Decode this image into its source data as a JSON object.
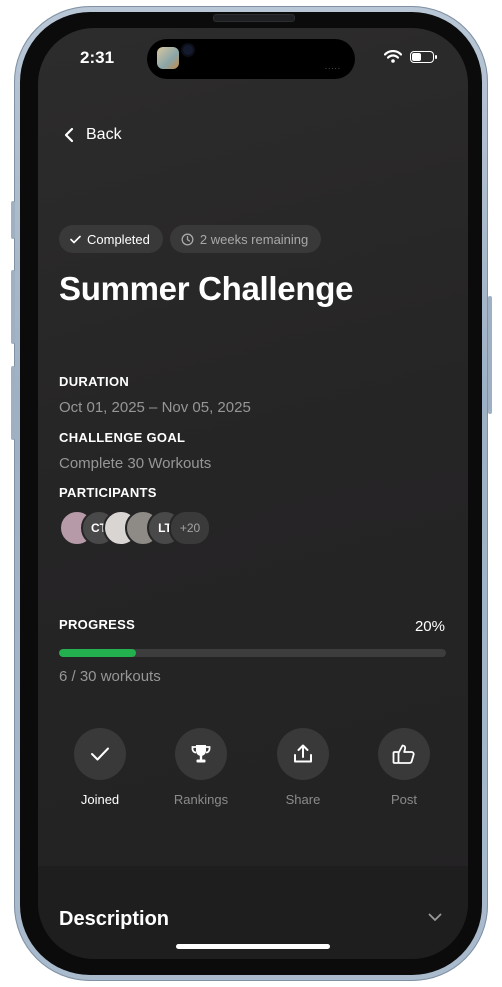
{
  "status_bar": {
    "time": "2:31",
    "island_dots": "....."
  },
  "nav": {
    "back_label": "Back"
  },
  "chips": {
    "completed": "Completed",
    "remaining": "2 weeks remaining"
  },
  "challenge": {
    "title": "Summer Challenge",
    "duration_label": "DURATION",
    "duration_value": "Oct 01, 2025 – Nov 05, 2025",
    "goal_label": "CHALLENGE GOAL",
    "goal_value": "Complete 30 Workouts",
    "participants_label": "PARTICIPANTS"
  },
  "participants": [
    {
      "initials": "",
      "color": "#b79aa8"
    },
    {
      "initials": "CT",
      "color": "#4a4949"
    },
    {
      "initials": "",
      "color": "#d8d5d2"
    },
    {
      "initials": "",
      "color": "#8e8a86"
    },
    {
      "initials": "LT",
      "color": "#4a4949"
    }
  ],
  "participants_more": "+20",
  "progress": {
    "label": "PROGRESS",
    "percent_label": "20%",
    "fraction": 0.2,
    "count_label": "6 / 30 workouts",
    "bar_color": "#23b04e"
  },
  "actions": [
    {
      "label": "Joined",
      "icon": "check-icon",
      "active": true
    },
    {
      "label": "Rankings",
      "icon": "trophy-icon",
      "active": false
    },
    {
      "label": "Share",
      "icon": "share-icon",
      "active": false
    },
    {
      "label": "Post",
      "icon": "thumbs-up-icon",
      "active": false
    }
  ],
  "description": {
    "title": "Description"
  }
}
